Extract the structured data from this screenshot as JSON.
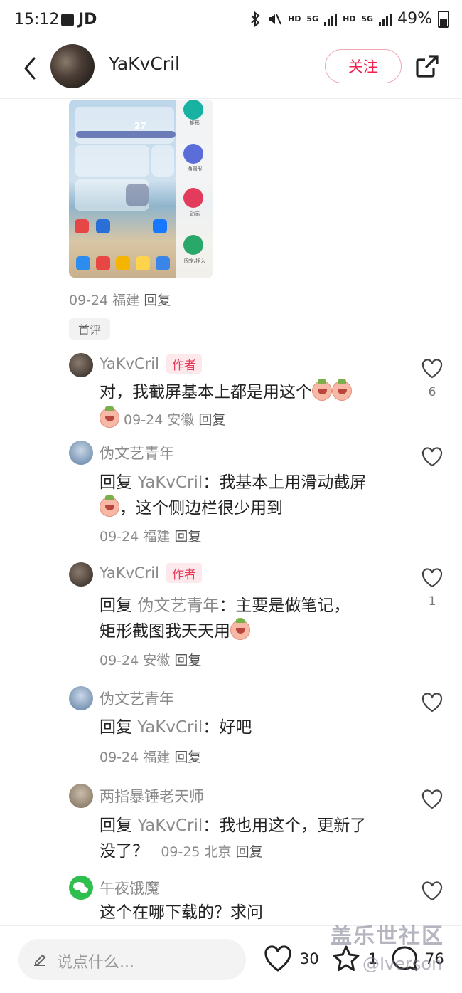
{
  "status_bar": {
    "time": "15:12",
    "app_badge": "JD",
    "net1": "HD",
    "net1_gen": "5G",
    "net2": "HD",
    "net2_gen": "5G",
    "battery": "49%"
  },
  "header": {
    "username": "YaKvCril",
    "follow_label": "关注"
  },
  "post": {
    "thumbnail": {
      "temp": "27",
      "panel_labels": [
        "矩形",
        "椭圆形",
        "动画",
        "固定/插入"
      ]
    },
    "date": "09-24",
    "location": "福建",
    "reply_label": "回复",
    "tag": "首评"
  },
  "comments": [
    {
      "name": "YaKvCril",
      "author_badge": "作者",
      "text": "对，我截屏基本上都是用这个",
      "date": "09-24",
      "location": "安徽",
      "reply_label": "回复",
      "likes": "6"
    },
    {
      "name": "伪文艺青年",
      "reply_prefix": "回复",
      "reply_to": "YaKvCril",
      "text1": "：我基本上用滑动截屏",
      "text2": "，这个侧边栏很少用到",
      "date": "09-24",
      "location": "福建",
      "reply_label": "回复",
      "likes": ""
    },
    {
      "name": "YaKvCril",
      "author_badge": "作者",
      "reply_prefix": "回复",
      "reply_to": "伪文艺青年",
      "text1": "：主要是做笔记，",
      "text2": "矩形截图我天天用",
      "date": "09-24",
      "location": "安徽",
      "reply_label": "回复",
      "likes": "1"
    },
    {
      "name": "伪文艺青年",
      "reply_prefix": "回复",
      "reply_to": "YaKvCril",
      "text1": "：好吧",
      "date": "09-24",
      "location": "福建",
      "reply_label": "回复",
      "likes": ""
    },
    {
      "name": "两指暴锤老天师",
      "reply_prefix": "回复",
      "reply_to": "YaKvCril",
      "text1": "：我也用这个，更新了",
      "text2": "没了？",
      "date": "09-25",
      "location": "北京",
      "reply_label": "回复",
      "likes": ""
    },
    {
      "name": "午夜饿魔",
      "text1": "这个在哪下载的？求问",
      "likes": ""
    }
  ],
  "bottom_bar": {
    "placeholder": "说点什么...",
    "like_count": "30",
    "fav_count": "1",
    "comment_count": "76"
  },
  "watermark": {
    "line1": "盖乐世社区",
    "line2": "@Iverson"
  },
  "colors": {
    "accent": "#f0214b",
    "author_badge_bg": "#fde9ec",
    "muted": "#8a8a8a"
  }
}
